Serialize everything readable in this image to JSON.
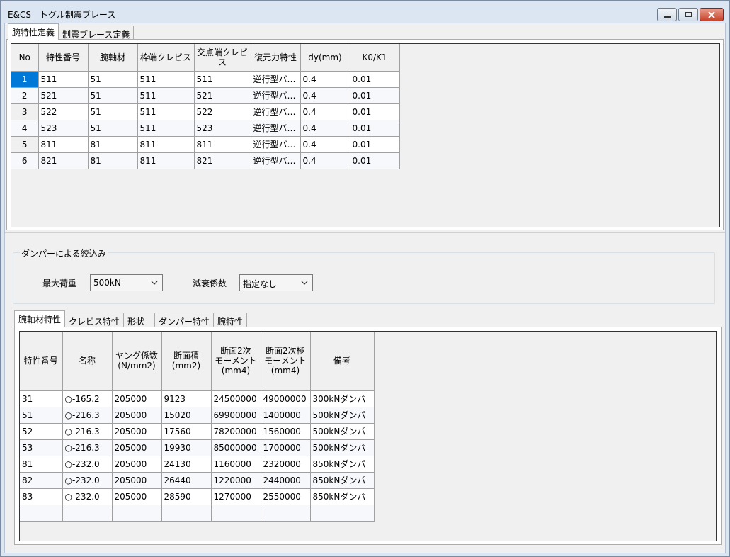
{
  "window": {
    "title": "E&CS　トグル制震ブレース",
    "controls": [
      "minimize",
      "maximize",
      "close"
    ]
  },
  "top_tabs": [
    "腕特性定義",
    "制震ブレース定義"
  ],
  "top_table": {
    "headers": [
      "No",
      "特性番号",
      "腕軸材",
      "枠端クレビス",
      "交点端クレビス",
      "復元力特性",
      "dy(mm)",
      "K0/K1"
    ],
    "rows": [
      [
        "1",
        "511",
        "51",
        "511",
        "511",
        "逆行型バ…",
        "0.4",
        "0.01"
      ],
      [
        "2",
        "521",
        "51",
        "511",
        "521",
        "逆行型バ…",
        "0.4",
        "0.01"
      ],
      [
        "3",
        "522",
        "51",
        "511",
        "522",
        "逆行型バ…",
        "0.4",
        "0.01"
      ],
      [
        "4",
        "523",
        "51",
        "511",
        "523",
        "逆行型バ…",
        "0.4",
        "0.01"
      ],
      [
        "5",
        "811",
        "81",
        "811",
        "811",
        "逆行型バ…",
        "0.4",
        "0.01"
      ],
      [
        "6",
        "821",
        "81",
        "811",
        "821",
        "逆行型バ…",
        "0.4",
        "0.01"
      ]
    ]
  },
  "damper_group": {
    "legend": "ダンパーによる絞込み",
    "max_load_label": "最大荷重",
    "max_load_value": "500kN",
    "damping_label": "減衰係数",
    "damping_value": "指定なし"
  },
  "bottom_tabs": [
    "腕軸材特性",
    "クレビス特性",
    "形状",
    "ダンパー特性",
    "腕特性"
  ],
  "bottom_table": {
    "headers": [
      "特性番号",
      "名称",
      "ヤング係数\n(N/mm2)",
      "断面積\n(mm2)",
      "断面2次\nモーメント\n(mm4)",
      "断面2次極\nモーメント\n(mm4)",
      "備考"
    ],
    "rows": [
      [
        "31",
        "○-165.2",
        "205000",
        "9123",
        "24500000",
        "49000000",
        "300kNダンパ"
      ],
      [
        "51",
        "○-216.3",
        "205000",
        "15020",
        "69900000",
        "1400000",
        "500kNダンパ"
      ],
      [
        "52",
        "○-216.3",
        "205000",
        "17560",
        "78200000",
        "1560000",
        "500kNダンパ"
      ],
      [
        "53",
        "○-216.3",
        "205000",
        "19930",
        "85000000",
        "1700000",
        "500kNダンパ"
      ],
      [
        "81",
        "○-232.0",
        "205000",
        "24130",
        "1160000",
        "2320000",
        "850kNダンパ"
      ],
      [
        "82",
        "○-232.0",
        "205000",
        "26440",
        "1220000",
        "2440000",
        "850kNダンパ"
      ],
      [
        "83",
        "○-232.0",
        "205000",
        "28590",
        "1270000",
        "2550000",
        "850kNダンパ"
      ],
      [
        "",
        "",
        "",
        "",
        "",
        "",
        ""
      ]
    ]
  }
}
